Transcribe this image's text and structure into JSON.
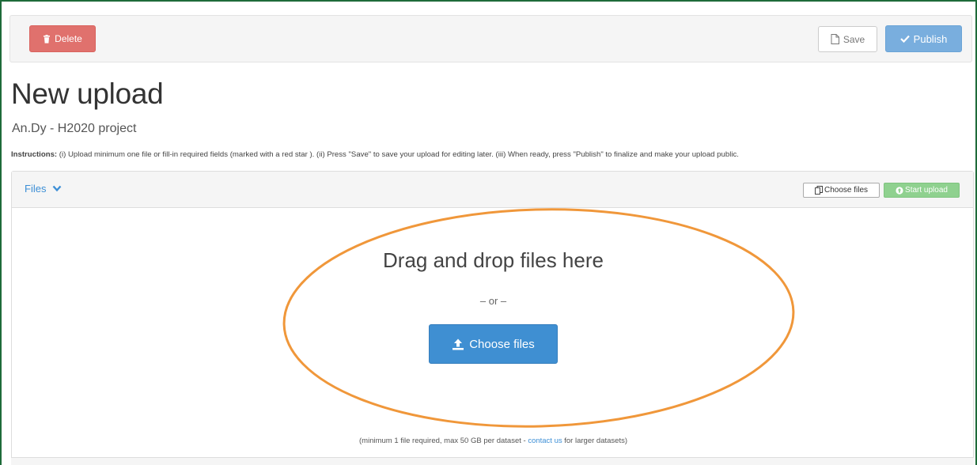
{
  "toolbar": {
    "delete_label": "Delete",
    "save_label": "Save",
    "publish_label": "Publish"
  },
  "page": {
    "title": "New upload",
    "subtitle": "An.Dy - H2020 project",
    "instructions_label": "Instructions:",
    "instructions_text": "(i) Upload minimum one file or fill-in required fields (marked with a red star ). (ii) Press \"Save\" to save your upload for editing later. (iii) When ready, press \"Publish\" to finalize and make your upload public."
  },
  "files_panel": {
    "toggle_label": "Files",
    "choose_files_small": "Choose files",
    "start_upload_label": "Start upload",
    "drop_text": "Drag and drop files here",
    "or_text": "– or –",
    "choose_files_big": "Choose files",
    "footnote_before": "(minimum 1 file required, max 50 GB per dataset - ",
    "footnote_link": "contact us",
    "footnote_after": " for larger datasets)"
  },
  "colors": {
    "frame": "#1e6b3a",
    "delete": "#e0716d",
    "publish": "#79aede",
    "start_upload": "#8fd18f",
    "primary": "#3f8fd2",
    "annotation": "#f0973a"
  },
  "icons": {
    "delete": "trash-icon",
    "save": "file-icon",
    "publish": "check-icon",
    "toggle": "chevron-down-icon",
    "choose_small": "files-icon",
    "start_upload": "upload-circle-icon",
    "choose_big": "upload-icon"
  }
}
